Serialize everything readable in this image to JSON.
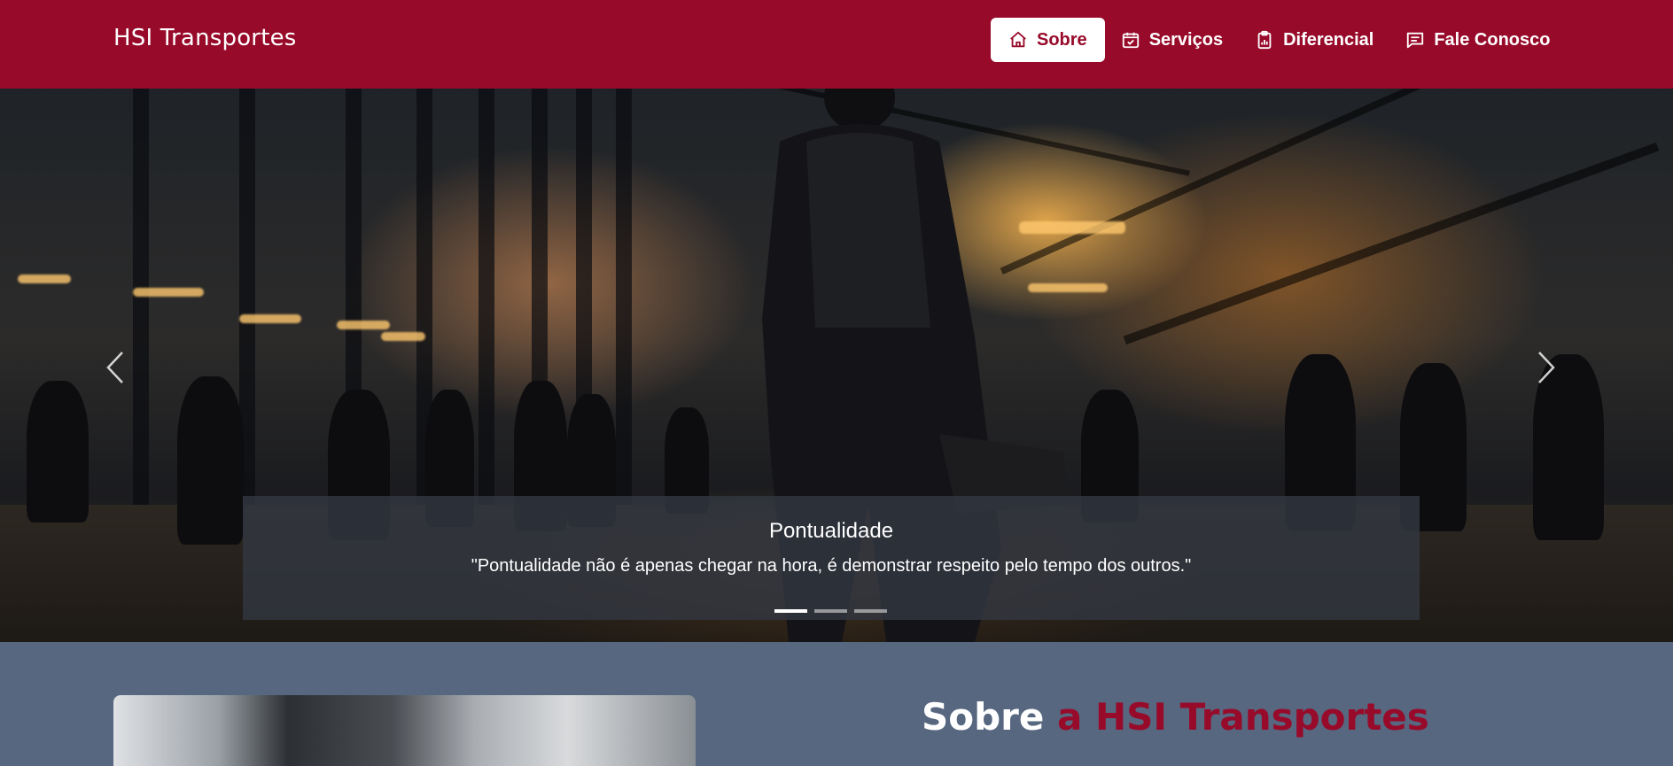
{
  "navbar": {
    "brand": "HSI Transportes",
    "items": [
      {
        "label": "Sobre",
        "icon": "home-icon",
        "active": true
      },
      {
        "label": "Serviços",
        "icon": "calendar-check-icon",
        "active": false
      },
      {
        "label": "Diferencial",
        "icon": "clipboard-chart-icon",
        "active": false
      },
      {
        "label": "Fale Conosco",
        "icon": "message-icon",
        "active": false
      }
    ]
  },
  "carousel": {
    "caption_title": "Pontualidade",
    "caption_text": "\"Pontualidade não é apenas chegar na hora, é demonstrar respeito pelo tempo dos outros.\"",
    "slide_count": 3,
    "active_index": 0,
    "prev_icon": "chevron-left-icon",
    "next_icon": "chevron-right-icon"
  },
  "about": {
    "title_plain": "Sobre",
    "title_accent": "a HSI Transportes"
  },
  "colors": {
    "brand": "#980a2a",
    "section_bg": "#56677f",
    "caption_bg": "#32373f"
  }
}
